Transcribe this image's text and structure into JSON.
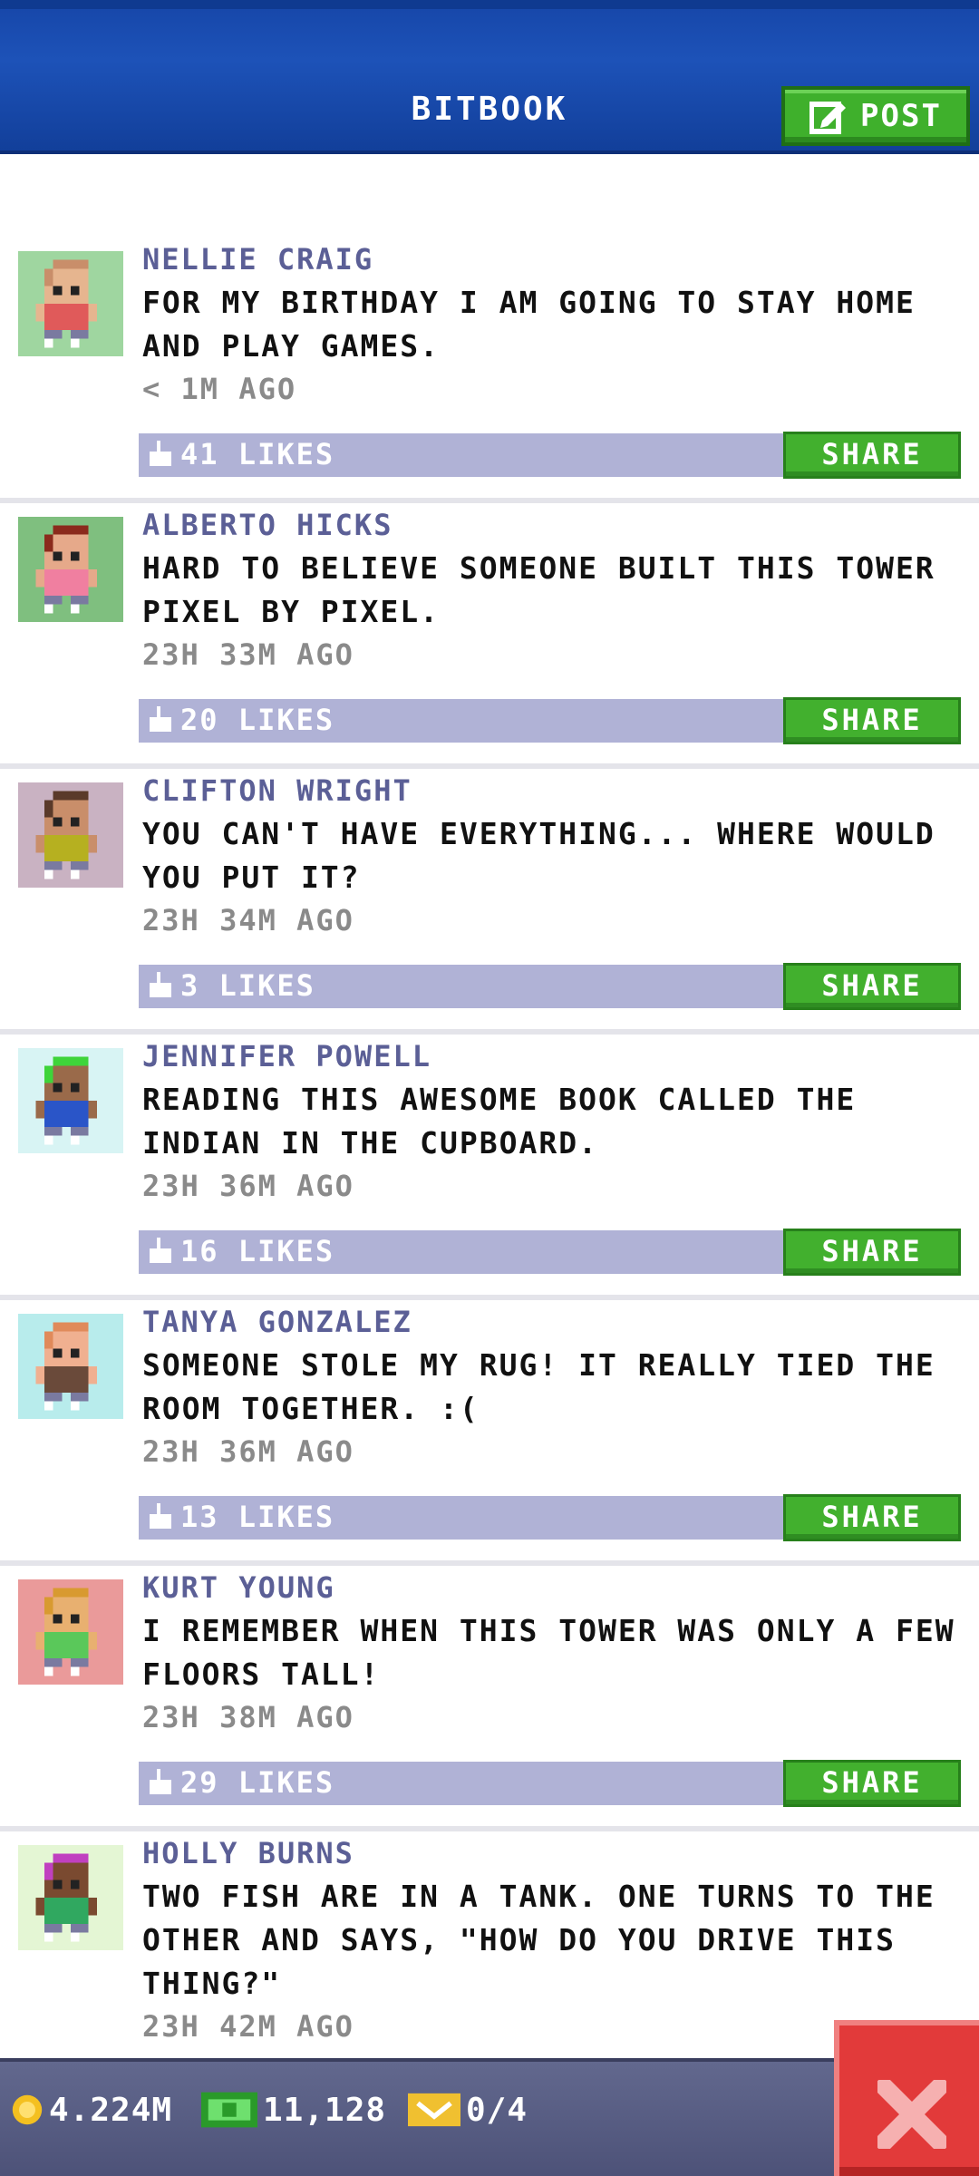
{
  "header": {
    "title": "BITBOOK",
    "post_label": "POST"
  },
  "colors": {
    "header_blue": "#1d52b8",
    "button_green": "#42b02e",
    "like_bar": "#b0b2d6",
    "name_color": "#5b5f96",
    "close_red": "#e23a3a"
  },
  "share_label": "SHARE",
  "posts": [
    {
      "name": "NELLIE CRAIG",
      "message": "FOR MY BIRTHDAY I AM GOING TO STAY HOME AND PLAY GAMES.",
      "time": "< 1M AGO",
      "likes": "41 LIKES",
      "avatar_bg": "#9fd6a0",
      "skin": "#e6b58f",
      "hair": "#c98e6a",
      "shirt": "#e05a5a"
    },
    {
      "name": "ALBERTO HICKS",
      "message": "HARD TO BELIEVE SOMEONE BUILT THIS TOWER PIXEL BY PIXEL.",
      "time": "23H 33M AGO",
      "likes": "20 LIKES",
      "avatar_bg": "#7fbf7f",
      "skin": "#e6a98a",
      "hair": "#8b2a1c",
      "shirt": "#f07fa0"
    },
    {
      "name": "CLIFTON WRIGHT",
      "message": "YOU CAN'T HAVE EVERYTHING... WHERE WOULD YOU PUT IT?",
      "time": "23H 34M AGO",
      "likes": "3 LIKES",
      "avatar_bg": "#c9b2c2",
      "skin": "#c98e6a",
      "hair": "#5a3a2a",
      "shirt": "#b6b020"
    },
    {
      "name": "JENNIFER POWELL",
      "message": "READING THIS AWESOME BOOK CALLED THE INDIAN IN THE CUPBOARD.",
      "time": "23H 36M AGO",
      "likes": "16 LIKES",
      "avatar_bg": "#d8f4f4",
      "skin": "#9a6a4a",
      "hair": "#3ed43a",
      "shirt": "#2a55c8"
    },
    {
      "name": "TANYA GONZALEZ",
      "message": "SOMEONE STOLE MY RUG! IT REALLY TIED THE ROOM TOGETHER. :(",
      "time": "23H 36M AGO",
      "likes": "13 LIKES",
      "avatar_bg": "#b8ecec",
      "skin": "#f0b090",
      "hair": "#e08a5a",
      "shirt": "#6a4a3a"
    },
    {
      "name": "KURT YOUNG",
      "message": "I REMEMBER WHEN THIS TOWER WAS ONLY A FEW FLOORS TALL!",
      "time": "23H 38M AGO",
      "likes": "29 LIKES",
      "avatar_bg": "#ea9a9a",
      "skin": "#e8b070",
      "hair": "#d89a30",
      "shirt": "#5ac85a"
    },
    {
      "name": "HOLLY BURNS",
      "message": "TWO FISH ARE IN A TANK. ONE TURNS TO THE OTHER AND SAYS, \"HOW DO YOU DRIVE THIS THING?\"",
      "time": "23H 42M AGO",
      "likes": "",
      "avatar_bg": "#e4f6d4",
      "skin": "#7a4a30",
      "hair": "#c040c0",
      "shirt": "#30a860"
    }
  ],
  "status": {
    "coins": "4.224M",
    "bux": "11,128",
    "tickets": "0/4"
  }
}
